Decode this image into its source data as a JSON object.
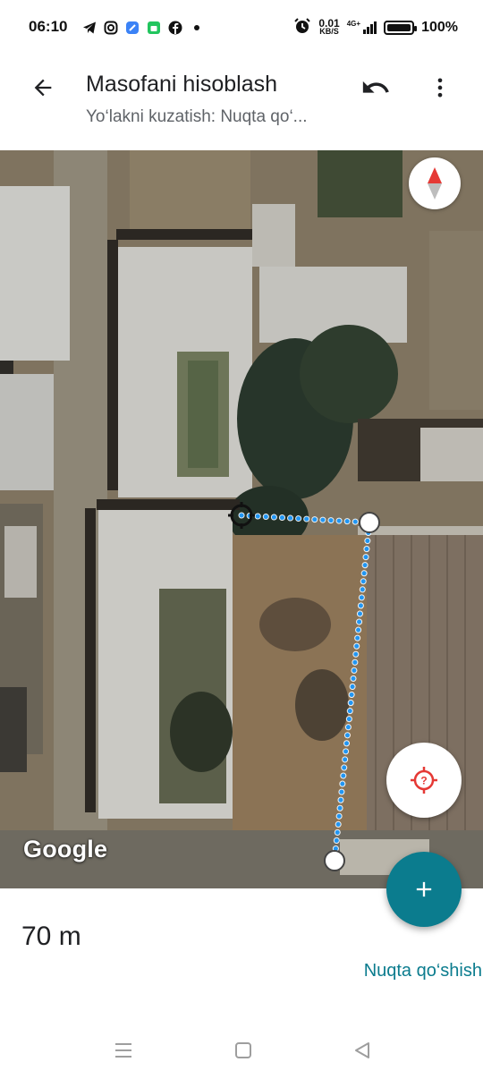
{
  "status_bar": {
    "time": "06:10",
    "net_speed_value": "0.01",
    "net_speed_unit": "KB/S",
    "network": "4G+",
    "battery": "100%",
    "left_icons": [
      "telegram-icon",
      "instagram-icon",
      "app-icon",
      "android-icon",
      "facebook-icon",
      "dot-icon"
    ],
    "right_icons": [
      "alarm-icon",
      "signal-icon",
      "battery-icon"
    ]
  },
  "appbar": {
    "title": "Masofani hisoblash",
    "subtitle": "Yo‘lakni kuzatish: Nuqta qo‘...",
    "back_icon": "arrow-back-icon",
    "undo_icon": "undo-icon",
    "menu_icon": "more-vert-icon"
  },
  "map": {
    "attribution": "Google",
    "compass_icon": "compass-icon",
    "locate_icon": "my-location-icon",
    "route_color": "#2196f3"
  },
  "bottom": {
    "distance": "70 m",
    "add_point_label": "Nuqta qo‘shish",
    "fab_icon": "plus-icon",
    "accent_color": "#0b7c8e"
  },
  "navbar": {
    "items": [
      "recent-apps-icon",
      "home-icon",
      "back-icon"
    ]
  }
}
